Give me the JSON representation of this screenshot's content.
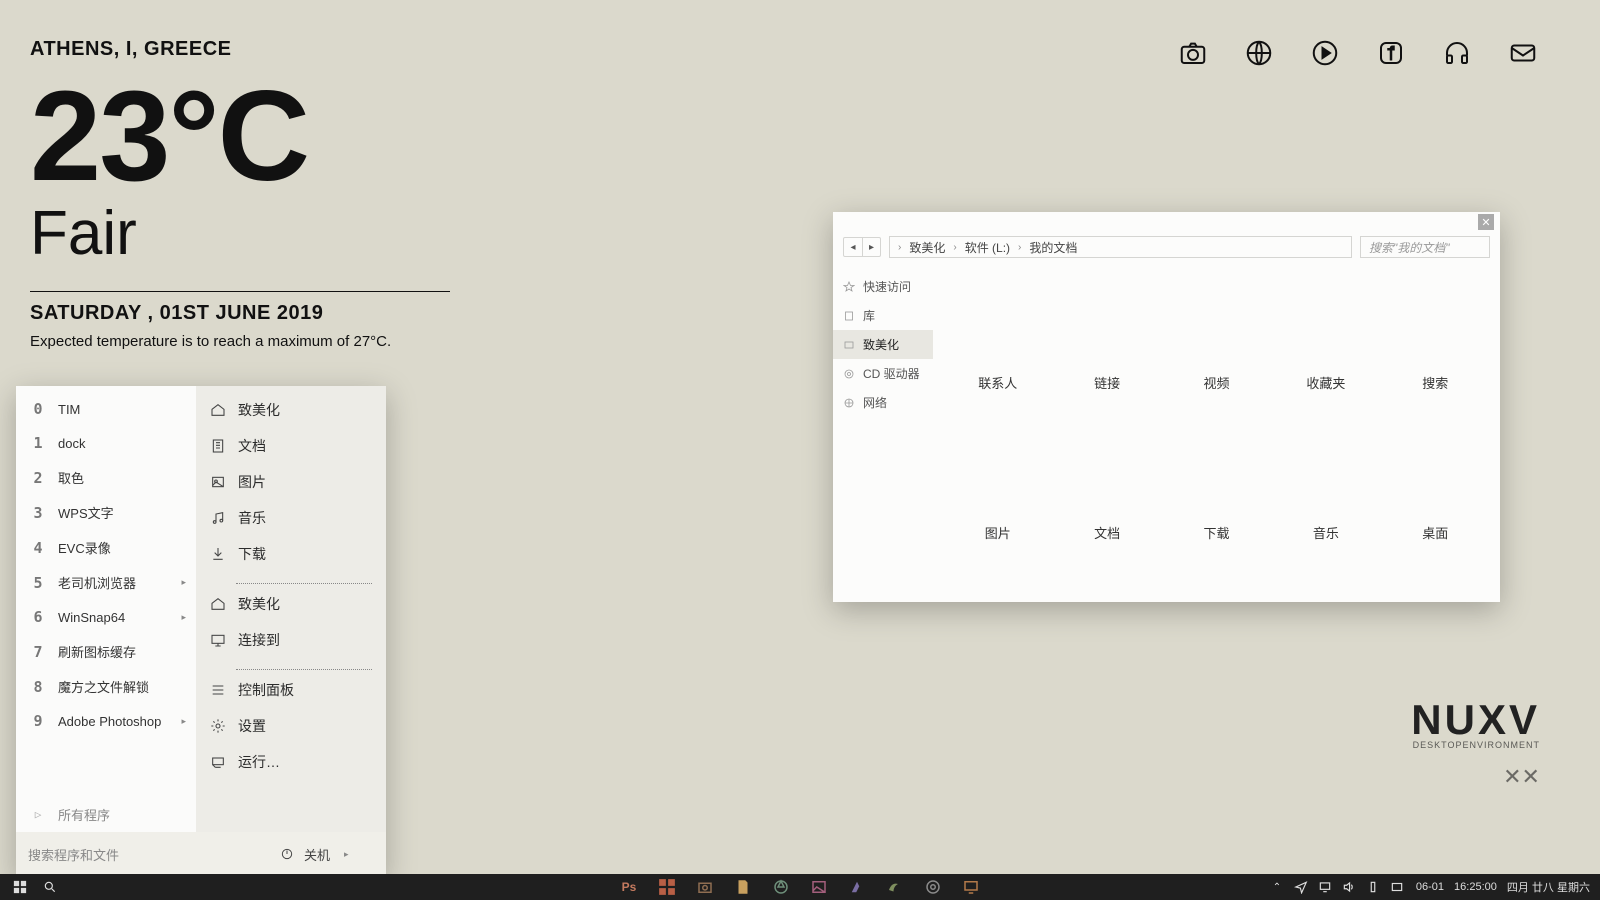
{
  "weather": {
    "location": "ATHENS, I, GREECE",
    "temp": "23°C",
    "condition": "Fair",
    "date": "SATURDAY , 01ST JUNE 2019",
    "forecast": "Expected temperature is to reach a maximum of 27°C."
  },
  "launcher": {
    "items": [
      "camera",
      "globe",
      "play",
      "facebook",
      "headphones",
      "mail"
    ]
  },
  "startmenu": {
    "left": [
      {
        "num": "0",
        "label": "TIM"
      },
      {
        "num": "1",
        "label": "dock"
      },
      {
        "num": "2",
        "label": "取色"
      },
      {
        "num": "3",
        "label": "WPS文字"
      },
      {
        "num": "4",
        "label": "EVC录像"
      },
      {
        "num": "5",
        "label": "老司机浏览器",
        "sub": true
      },
      {
        "num": "6",
        "label": "WinSnap64",
        "sub": true
      },
      {
        "num": "7",
        "label": "刷新图标缓存"
      },
      {
        "num": "8",
        "label": "魔方之文件解锁"
      },
      {
        "num": "9",
        "label": "Adobe Photoshop",
        "sub": true
      }
    ],
    "allprograms": "所有程序",
    "right": [
      {
        "icon": "home",
        "label": "致美化"
      },
      {
        "icon": "doc",
        "label": "文档"
      },
      {
        "icon": "image",
        "label": "图片"
      },
      {
        "icon": "music",
        "label": "音乐"
      },
      {
        "icon": "download",
        "label": "下载"
      },
      {
        "sep": true
      },
      {
        "icon": "home",
        "label": "致美化"
      },
      {
        "icon": "monitor",
        "label": "连接到"
      },
      {
        "sep": true
      },
      {
        "icon": "sliders",
        "label": "控制面板"
      },
      {
        "icon": "gear",
        "label": "设置"
      },
      {
        "icon": "run",
        "label": "运行…"
      }
    ],
    "search_placeholder": "搜索程序和文件",
    "shutdown": "关机"
  },
  "explorer": {
    "breadcrumb": [
      "致美化",
      "软件 (L:)",
      "我的文档"
    ],
    "search_placeholder": "搜索\"我的文档\"",
    "sidebar": [
      {
        "icon": "star",
        "label": "快速访问"
      },
      {
        "icon": "lib",
        "label": "库"
      },
      {
        "icon": "folder",
        "label": "致美化",
        "sel": true
      },
      {
        "icon": "disc",
        "label": "CD 驱动器"
      },
      {
        "icon": "net",
        "label": "网络"
      }
    ],
    "folders": [
      "联系人",
      "链接",
      "视频",
      "收藏夹",
      "搜索",
      "图片",
      "文档",
      "下载",
      "音乐",
      "桌面"
    ]
  },
  "brand": {
    "big": "NUXV",
    "small": "DESKTOPENVIRONMENT"
  },
  "taskbar": {
    "center_colors": [
      "#c47a5f",
      "#b85f45",
      "#8f6e52",
      "#c8a05f",
      "#6e8f7a",
      "#a35f7c",
      "#7a6ea3",
      "#7f8f5f",
      "#8a8a8a",
      "#b37a4a"
    ],
    "tray_date": "06-01",
    "tray_time": "16:25:00",
    "tray_lunar": "四月 廿八 星期六"
  }
}
